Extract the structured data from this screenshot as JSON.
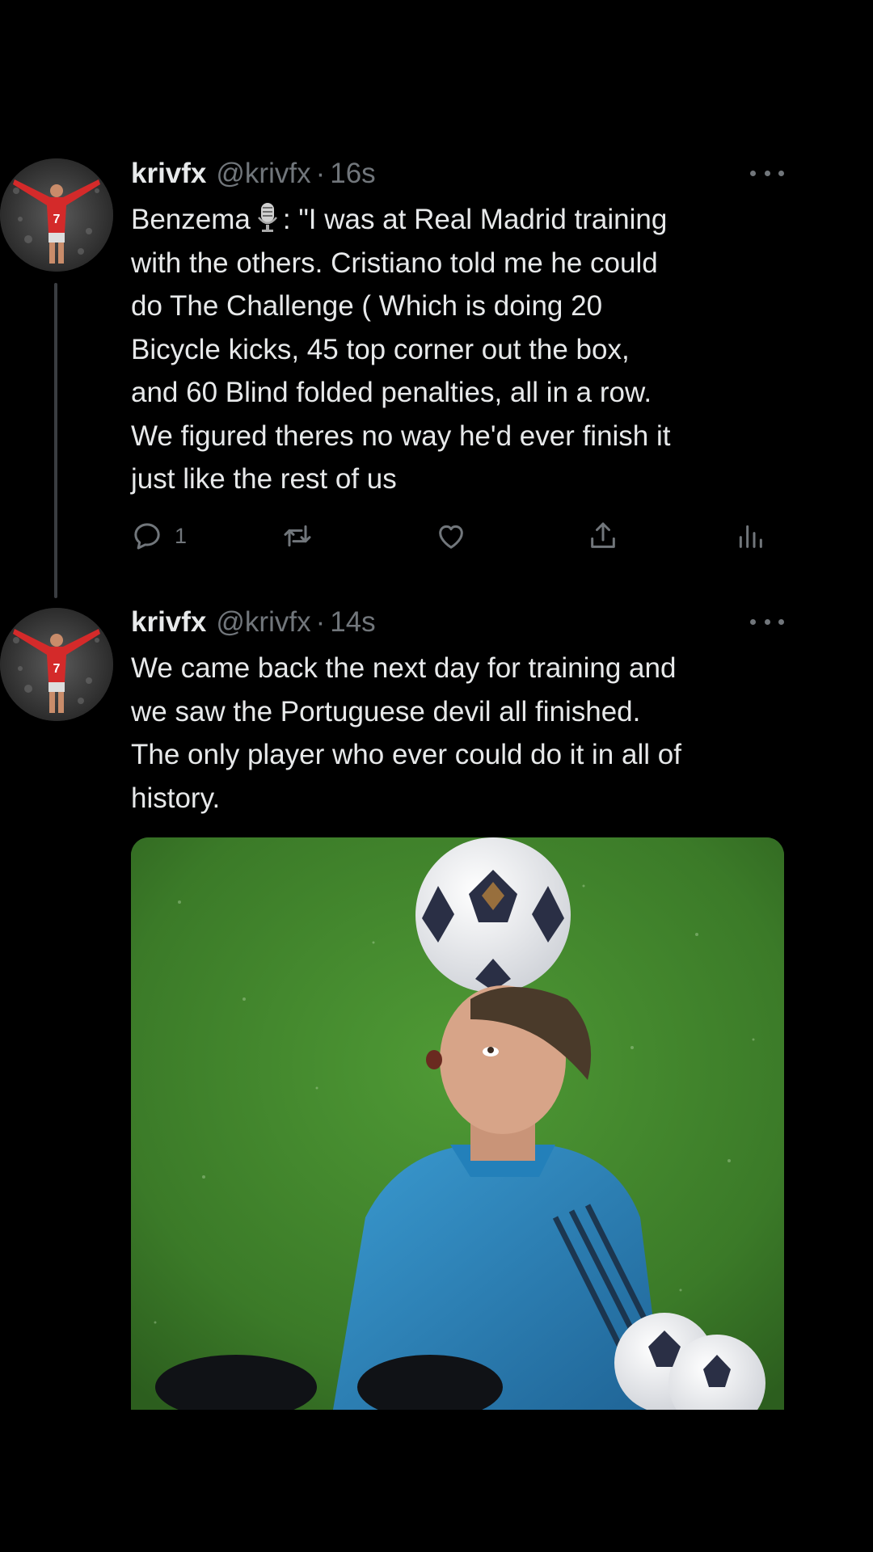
{
  "tweets": [
    {
      "name": "krivfx",
      "handle": "@krivfx",
      "separator": "·",
      "time": "16s",
      "lines": [
        "\"I was at Real Madrid training",
        "with the others. Cristiano told me he could",
        "do The Challenge ( Which is doing 20",
        "Bicycle kicks, 45 top corner out the box,",
        "and 60 Blind folded penalties, all in a row.",
        "We figured theres no way he'd ever finish it",
        "just like the rest of us"
      ],
      "lead": "Benzema",
      "lead_suffix": ":",
      "actions": {
        "reply_count": "1"
      }
    },
    {
      "name": "krivfx",
      "handle": "@krivfx",
      "separator": "·",
      "time": "14s",
      "lines": [
        "We came back the next day for training and",
        "we saw the Portuguese devil all finished.",
        "The only player who ever could do it in all of",
        "history."
      ]
    }
  ],
  "icons": {
    "avatar": "avatar-icon",
    "more": "more-icon",
    "reply": "reply-icon",
    "retweet": "retweet-icon",
    "like": "heart-icon",
    "share": "share-icon",
    "analytics": "analytics-icon",
    "mic": "microphone-icon"
  },
  "colors": {
    "background": "#000000",
    "text": "#e7e9ea",
    "muted": "#71767b",
    "thread_line": "#3a3d41"
  }
}
